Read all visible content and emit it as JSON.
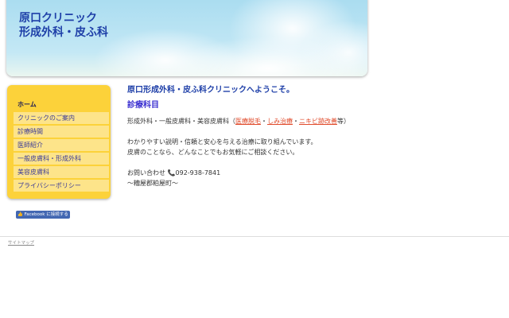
{
  "header": {
    "logo_line1": "原口クリニック",
    "logo_line2": "形成外科・皮ふ科"
  },
  "sidebar": {
    "items": [
      {
        "label": "ホーム"
      },
      {
        "label": "クリニックのご案内"
      },
      {
        "label": "診療時間"
      },
      {
        "label": "医師紹介"
      },
      {
        "label": "一般皮膚科・形成外科"
      },
      {
        "label": "美容皮膚科"
      },
      {
        "label": "プライバシーポリシー"
      }
    ]
  },
  "facebook": {
    "label": "Facebook に接続する"
  },
  "main": {
    "welcome": "原口形成外科・皮ふ科クリニックへようこそ。",
    "section_title": "診療科目",
    "departments_prefix": "形成外科・一般皮膚科・美容皮膚科（",
    "links": [
      "医療脱毛",
      "しみ治療",
      "ニキビ跡改善"
    ],
    "sep": "・",
    "departments_suffix": "等）",
    "line1": "わかりやすい説明・信頼と安心を与える治療に取り組んでいます。",
    "line2": "皮膚のことなら、どんなことでもお気軽にご相談ください。",
    "contact_label": "お問い合わせ",
    "phone": "092-938-7841",
    "location": "〜糟屋郡粕屋町〜"
  },
  "footer": {
    "sitemap": "サイトマップ"
  }
}
